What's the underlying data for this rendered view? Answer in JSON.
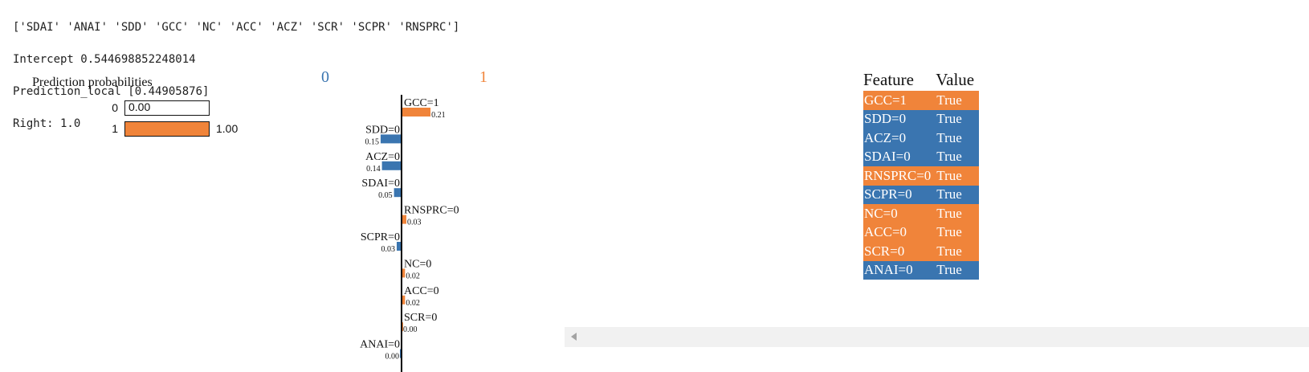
{
  "output": {
    "line1": "['SDAI' 'ANAI' 'SDD' 'GCC' 'NC' 'ACC' 'ACZ' 'SCR' 'SCPR' 'RNSPRC']",
    "line2": "Intercept 0.544698852248014",
    "line3": "Prediction_local [0.44905876]",
    "line4": "Right: 1.0"
  },
  "colors": {
    "class0": "#3a75b0",
    "class1": "#f0843a"
  },
  "chart_data": [
    {
      "type": "bar",
      "title": "Prediction probabilities",
      "categories": [
        "0",
        "1"
      ],
      "values": [
        0.0,
        1.0
      ],
      "value_labels": [
        "0.00",
        "1.00"
      ],
      "xlim": [
        0,
        1
      ]
    },
    {
      "type": "bar",
      "orientation": "horizontal",
      "class_labels": [
        "0",
        "1"
      ],
      "categories": [
        "GCC=1",
        "SDD=0",
        "ACZ=0",
        "SDAI=0",
        "RNSPRC=0",
        "SCPR=0",
        "NC=0",
        "ACC=0",
        "SCR=0",
        "ANAI=0"
      ],
      "values": [
        0.21,
        -0.15,
        -0.14,
        -0.05,
        0.03,
        -0.03,
        0.02,
        0.02,
        0.0,
        -0.0
      ],
      "value_labels": [
        "0.21",
        "0.15",
        "0.14",
        "0.05",
        "0.03",
        "0.03",
        "0.02",
        "0.02",
        "0.00",
        "0.00"
      ]
    }
  ],
  "feature_table": {
    "header_feature": "Feature",
    "header_value": "Value",
    "rows": [
      {
        "feature": "GCC=1",
        "value": "True",
        "class": 1
      },
      {
        "feature": "SDD=0",
        "value": "True",
        "class": 0
      },
      {
        "feature": "ACZ=0",
        "value": "True",
        "class": 0
      },
      {
        "feature": "SDAI=0",
        "value": "True",
        "class": 0
      },
      {
        "feature": "RNSPRC=0",
        "value": "True",
        "class": 1
      },
      {
        "feature": "SCPR=0",
        "value": "True",
        "class": 0
      },
      {
        "feature": "NC=0",
        "value": "True",
        "class": 1
      },
      {
        "feature": "ACC=0",
        "value": "True",
        "class": 1
      },
      {
        "feature": "SCR=0",
        "value": "True",
        "class": 1
      },
      {
        "feature": "ANAI=0",
        "value": "True",
        "class": 0
      }
    ]
  },
  "scrollbar": {
    "left_arrow_icon": "triangle-left-icon"
  }
}
